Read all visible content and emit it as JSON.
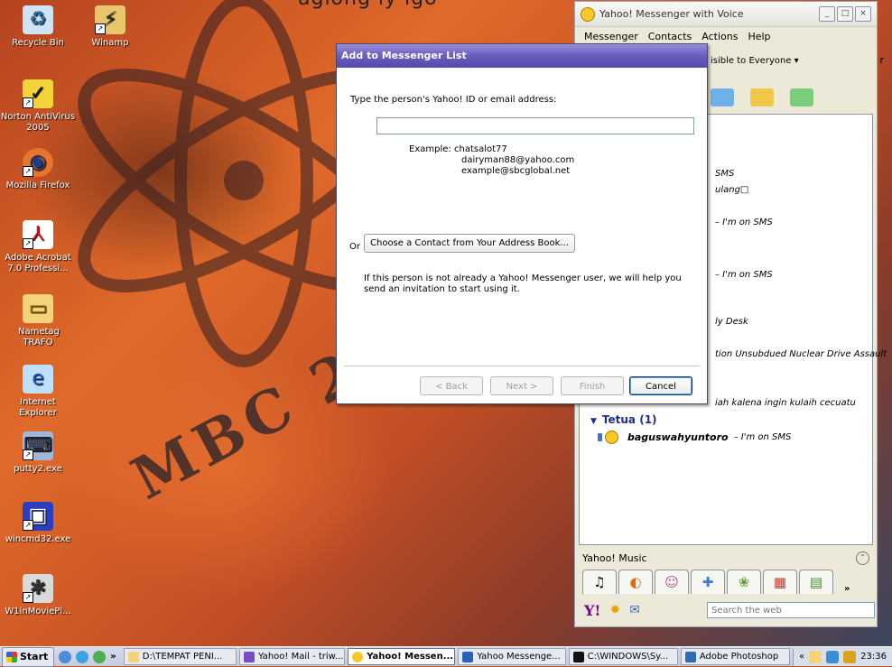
{
  "wallpaper": {
    "top_text": "agiong iy igo",
    "shirt_text": "MBC 200"
  },
  "desktop_icons": [
    {
      "label": "Recycle Bin"
    },
    {
      "label": "Winamp"
    },
    {
      "label": "Norton AntiVirus 2005"
    },
    {
      "label": "Mozilla Firefox"
    },
    {
      "label": "Adobe Acrobat 7.0 Professi..."
    },
    {
      "label": "Nametag TRAFO"
    },
    {
      "label": "Internet Explorer"
    },
    {
      "label": "putty2.exe"
    },
    {
      "label": "wincmd32.exe"
    },
    {
      "label": "W1inMoviePl..."
    }
  ],
  "messenger": {
    "title": "Yahoo! Messenger with Voice",
    "window_buttons": {
      "minimize": "_",
      "maximize": "□",
      "close": "×"
    },
    "menu": [
      "Messenger",
      "Contacts",
      "Actions",
      "Help"
    ],
    "visibility": "isible to Everyone ▾",
    "overflow_char": "r",
    "contact_fragments": [
      "SMS",
      "ulang□",
      "– I'm on SMS",
      "– I'm on SMS",
      "ly Desk",
      "tion Unsubdued Nuclear Drive Assault",
      "iah kalena ingin kulaih cecuatu"
    ],
    "group": {
      "name": "Tetua (1)",
      "arrow": "▼"
    },
    "contact": {
      "name": "baguswahyuntoro",
      "status": "– I'm on SMS"
    },
    "grip": "• • •",
    "music_label": "Yahoo! Music",
    "music_collapse": "⌃",
    "tabs_more": "»",
    "search_placeholder": "Search the web",
    "yahoo_logo": "Y!"
  },
  "dialog": {
    "title": "Add to Messenger List",
    "prompt": "Type the person's Yahoo! ID or email address:",
    "input_value": "",
    "example_label": "Example:",
    "examples": [
      "chatsalot77",
      "dairyman88@yahoo.com",
      "example@sbcglobal.net"
    ],
    "or_label": "Or",
    "address_book_button": "Choose a Contact from Your Address Book...",
    "invite_text": "If this person is not already a Yahoo! Messenger user, we will help you send an invitation to start using it.",
    "buttons": {
      "back": "< Back",
      "next": "Next >",
      "finish": "Finish",
      "cancel": "Cancel"
    }
  },
  "taskbar": {
    "start": "Start",
    "chevron": "»",
    "tasks": [
      {
        "label": "D:\\TEMPAT PENI..."
      },
      {
        "label": "Yahoo! Mail - triw..."
      },
      {
        "label": "Yahoo! Messen..."
      },
      {
        "label": "Yahoo Messenge..."
      },
      {
        "label": "C:\\WINDOWS\\Sy..."
      },
      {
        "label": "Adobe Photoshop"
      }
    ],
    "tray_chevron": "«",
    "clock": "23:36"
  }
}
